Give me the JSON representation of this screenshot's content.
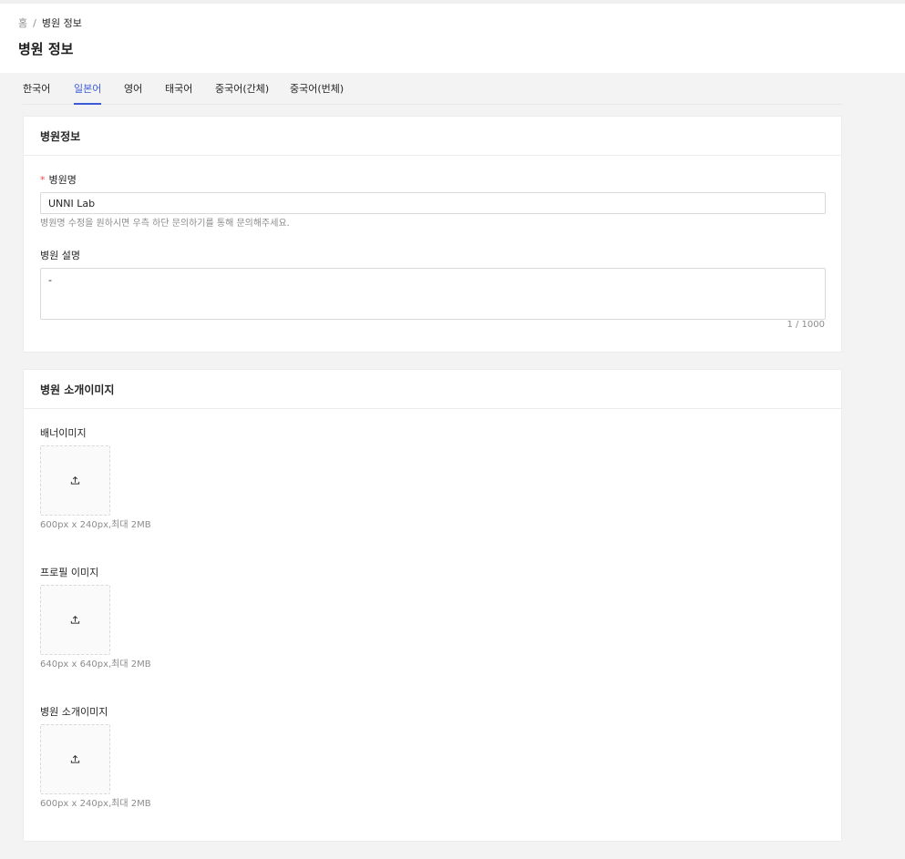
{
  "breadcrumb": {
    "home": "홈",
    "separator": "/",
    "current": "병원 정보"
  },
  "page_title": "병원 정보",
  "tabs": [
    {
      "label": "한국어"
    },
    {
      "label": "일본어",
      "active": true
    },
    {
      "label": "영어"
    },
    {
      "label": "태국어"
    },
    {
      "label": "중국어(간체)"
    },
    {
      "label": "중국어(번체)"
    }
  ],
  "info_card": {
    "title": "병원정보",
    "name_label": "병원명",
    "required_mark": "*",
    "name_value": "UNNI Lab",
    "name_help": "병원명 수정을 원하시면 우측 하단 문의하기를 통해 문의해주세요.",
    "desc_label": "병원 설명",
    "desc_value": "-",
    "desc_counter": "1 / 1000"
  },
  "image_card": {
    "title": "병원 소개이미지",
    "banner": {
      "label": "배너이미지",
      "hint": "600px x 240px,최대 2MB"
    },
    "profile": {
      "label": "프로필 이미지",
      "hint": "640px x 640px,최대 2MB"
    },
    "intro": {
      "label": "병원 소개이미지",
      "hint": "600px x 240px,최대 2MB"
    }
  },
  "colors": {
    "accent": "#3b5bdb",
    "required": "#ff4d4f"
  }
}
